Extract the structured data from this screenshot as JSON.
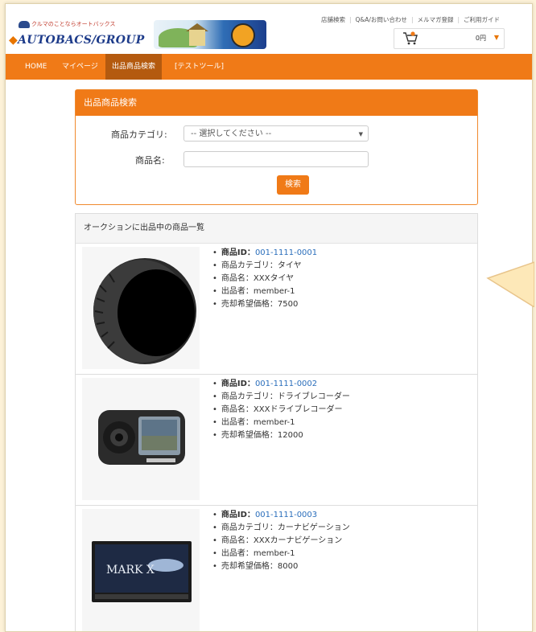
{
  "header": {
    "logo_tagline": "クルマのことならオートバックス",
    "logo_brand": "AUTOBACS",
    "logo_group": "GROUP",
    "top_links": [
      "店舗検索",
      "Q&A/お問い合わせ",
      "メルマガ登録",
      "ご利用ガイド"
    ],
    "cart_total": "0円",
    "cart_icon": "cart-icon"
  },
  "nav": {
    "items": [
      "HOME",
      "マイページ",
      "出品商品検索",
      "[テストツール]"
    ],
    "active_index": 2
  },
  "search": {
    "title": "出品商品検索",
    "category_label": "商品カテゴリ:",
    "category_value": "-- 選択してください --",
    "name_label": "商品名:",
    "name_value": "",
    "button": "検索"
  },
  "list": {
    "title": "オークションに出品中の商品一覧",
    "items": [
      {
        "id_label": "商品ID：",
        "id": "001-1111-0001",
        "category": "商品カテゴリ：タイヤ",
        "name": "商品名：XXXタイヤ",
        "seller": "出品者：member-1",
        "price": "売却希望価格：7500",
        "image": "tire-image"
      },
      {
        "id_label": "商品ID：",
        "id": "001-1111-0002",
        "category": "商品カテゴリ：ドライブレコーダー",
        "name": "商品名：XXXドライブレコーダー",
        "seller": "出品者：member-1",
        "price": "売却希望価格：12000",
        "image": "dashcam-image"
      },
      {
        "id_label": "商品ID：",
        "id": "001-1111-0003",
        "category": "商品カテゴリ：カーナビゲーション",
        "name": "商品名：XXXカーナビゲーション",
        "seller": "出品者：member-1",
        "price": "売却希望価格：8000",
        "image": "car-navigation-image",
        "image_text": "MARK X"
      }
    ]
  },
  "colors": {
    "accent": "#f07a17",
    "accent_dark": "#b45a0f",
    "brand_blue": "#1d3b8a",
    "link": "#2a6ebb",
    "page_bg": "#fdf2d8"
  }
}
